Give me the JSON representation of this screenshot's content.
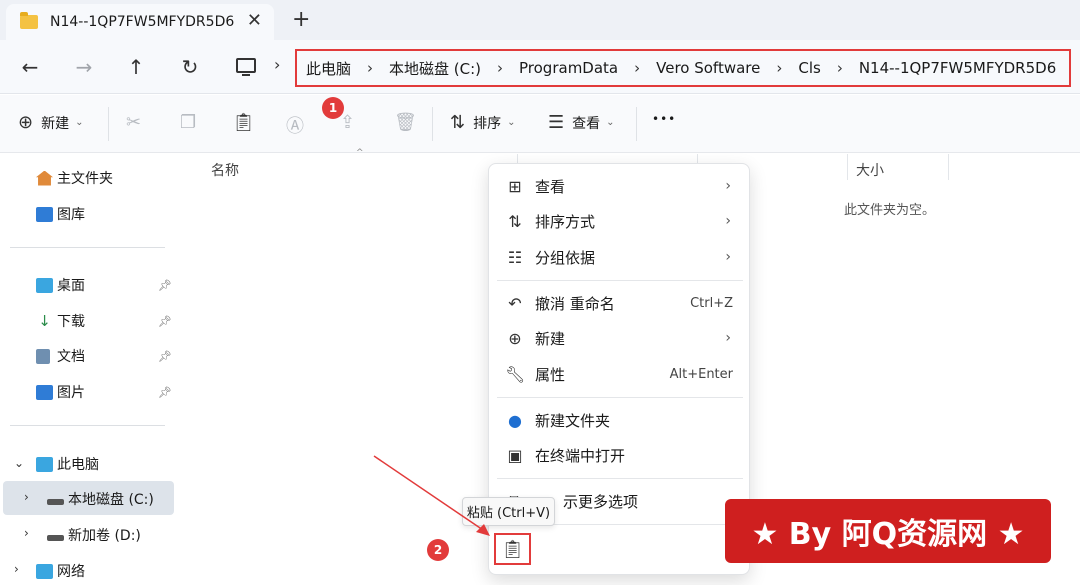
{
  "tab": {
    "title": "N14--1QP7FW5MFYDR5D6",
    "close": "✕",
    "new": "+"
  },
  "nav": {
    "back": "←",
    "forward": "→",
    "up": "↑",
    "refresh": "↻"
  },
  "breadcrumb": [
    "此电脑",
    "本地磁盘 (C:)",
    "ProgramData",
    "Vero Software",
    "Cls",
    "N14--1QP7FW5MFYDR5D6"
  ],
  "toolbar": {
    "new_label": "新建",
    "sort_label": "排序",
    "view_label": "查看",
    "more": "•••"
  },
  "badges": {
    "one": "1",
    "two": "2"
  },
  "sidebar": {
    "home": "主文件夹",
    "gallery": "图库",
    "desktop": "桌面",
    "downloads": "下载",
    "documents": "文档",
    "pictures": "图片",
    "this_pc": "此电脑",
    "drive_c": "本地磁盘 (C:)",
    "drive_d": "新加卷 (D:)",
    "network": "网络"
  },
  "filelist": {
    "col_name": "名称",
    "col_size": "大小",
    "empty_msg": "此文件夹为空。"
  },
  "context_menu": {
    "view": "查看",
    "sort": "排序方式",
    "group": "分组依据",
    "undo": "撤消 重命名",
    "undo_shortcut": "Ctrl+Z",
    "new": "新建",
    "properties": "属性",
    "properties_shortcut": "Alt+Enter",
    "new_folder": "新建文件夹",
    "terminal": "在终端中打开",
    "more_options": "示更多选项"
  },
  "tooltip": "粘贴 (Ctrl+V)",
  "watermark": "★ By 阿Q资源网 ★",
  "colors": {
    "accent_red": "#e23b3b",
    "folder": "#f4c242",
    "watermark_bg": "#cf1f1f"
  }
}
